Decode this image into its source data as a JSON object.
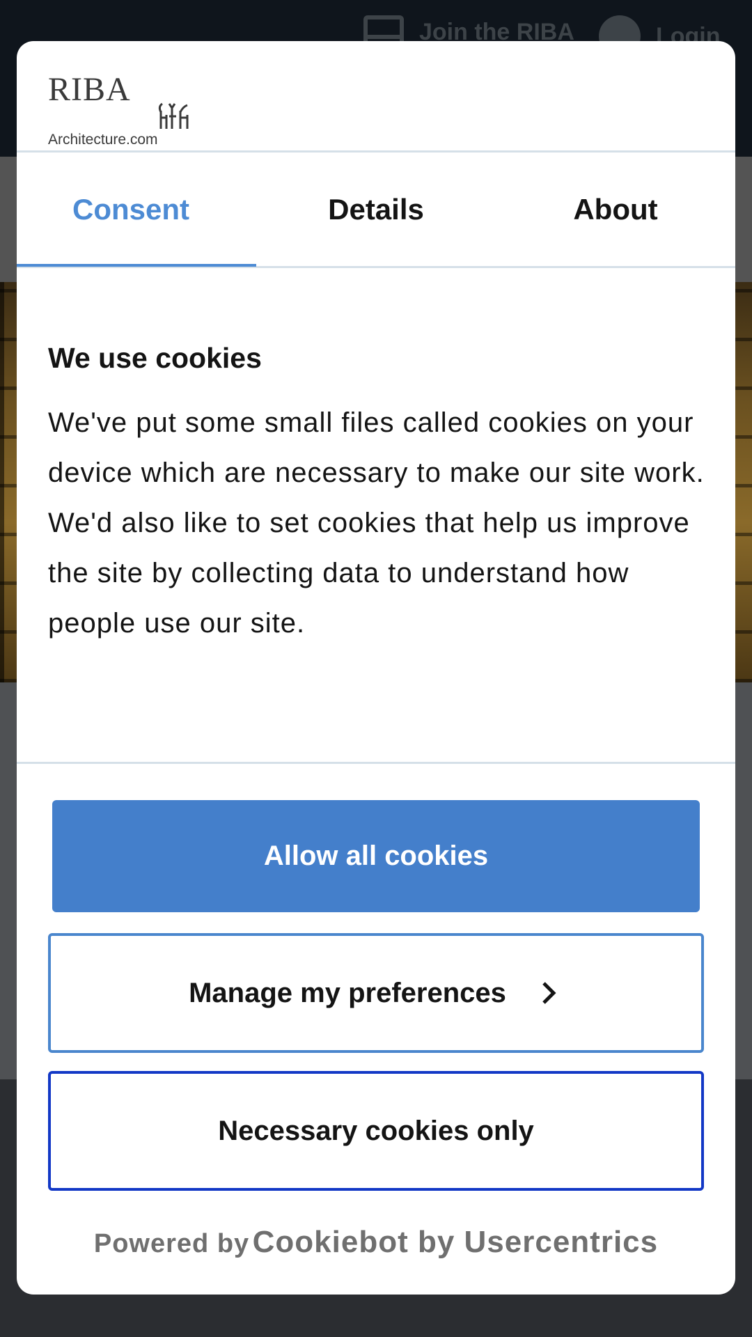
{
  "background": {
    "join_label": "Join the RIBA",
    "login_label": "Login"
  },
  "logo": {
    "wordmark": "RIBA",
    "site": "Architecture.com"
  },
  "tabs": [
    {
      "label": "Consent",
      "active": true
    },
    {
      "label": "Details",
      "active": false
    },
    {
      "label": "About",
      "active": false
    }
  ],
  "consent": {
    "heading": "We use cookies",
    "body": "We've put some small files called cookies on your device which are necessary to make our site work. We'd also like to set cookies that help us improve the site by collecting data to understand how people use our site."
  },
  "buttons": {
    "allow_all": "Allow all cookies",
    "manage": "Manage my preferences",
    "necessary": "Necessary cookies only"
  },
  "footer": {
    "powered_by": "Powered by",
    "brand": "Cookiebot by Usercentrics"
  },
  "colors": {
    "accent": "#447fcb",
    "necessary_border": "#1238c6",
    "overlay_header": "#0f151c"
  }
}
